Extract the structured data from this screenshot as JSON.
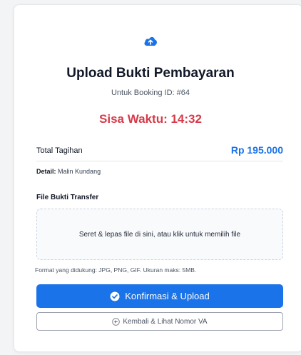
{
  "header": {
    "icon": "cloud-upload-icon",
    "title": "Upload Bukti Pembayaran",
    "subtitle": "Untuk Booking ID: #64"
  },
  "timer": {
    "text": "Sisa Waktu: 14:32",
    "color": "#d73a49"
  },
  "billing": {
    "total_label": "Total Tagihan",
    "total_value": "Rp 195.000",
    "detail_label": "Detail:",
    "detail_value": "Malin Kundang"
  },
  "upload": {
    "label": "File Bukti Transfer",
    "dropzone_text": "Seret & lepas file di sini, atau klik untuk memilih file",
    "format_note": "Format yang didukung: JPG, PNG, GIF. Ukuran maks: 5MB."
  },
  "actions": {
    "confirm_label": "Konfirmasi & Upload",
    "back_label": "Kembali & Lihat Nomor VA"
  },
  "colors": {
    "accent": "#1a73e8",
    "danger": "#d73a49"
  }
}
